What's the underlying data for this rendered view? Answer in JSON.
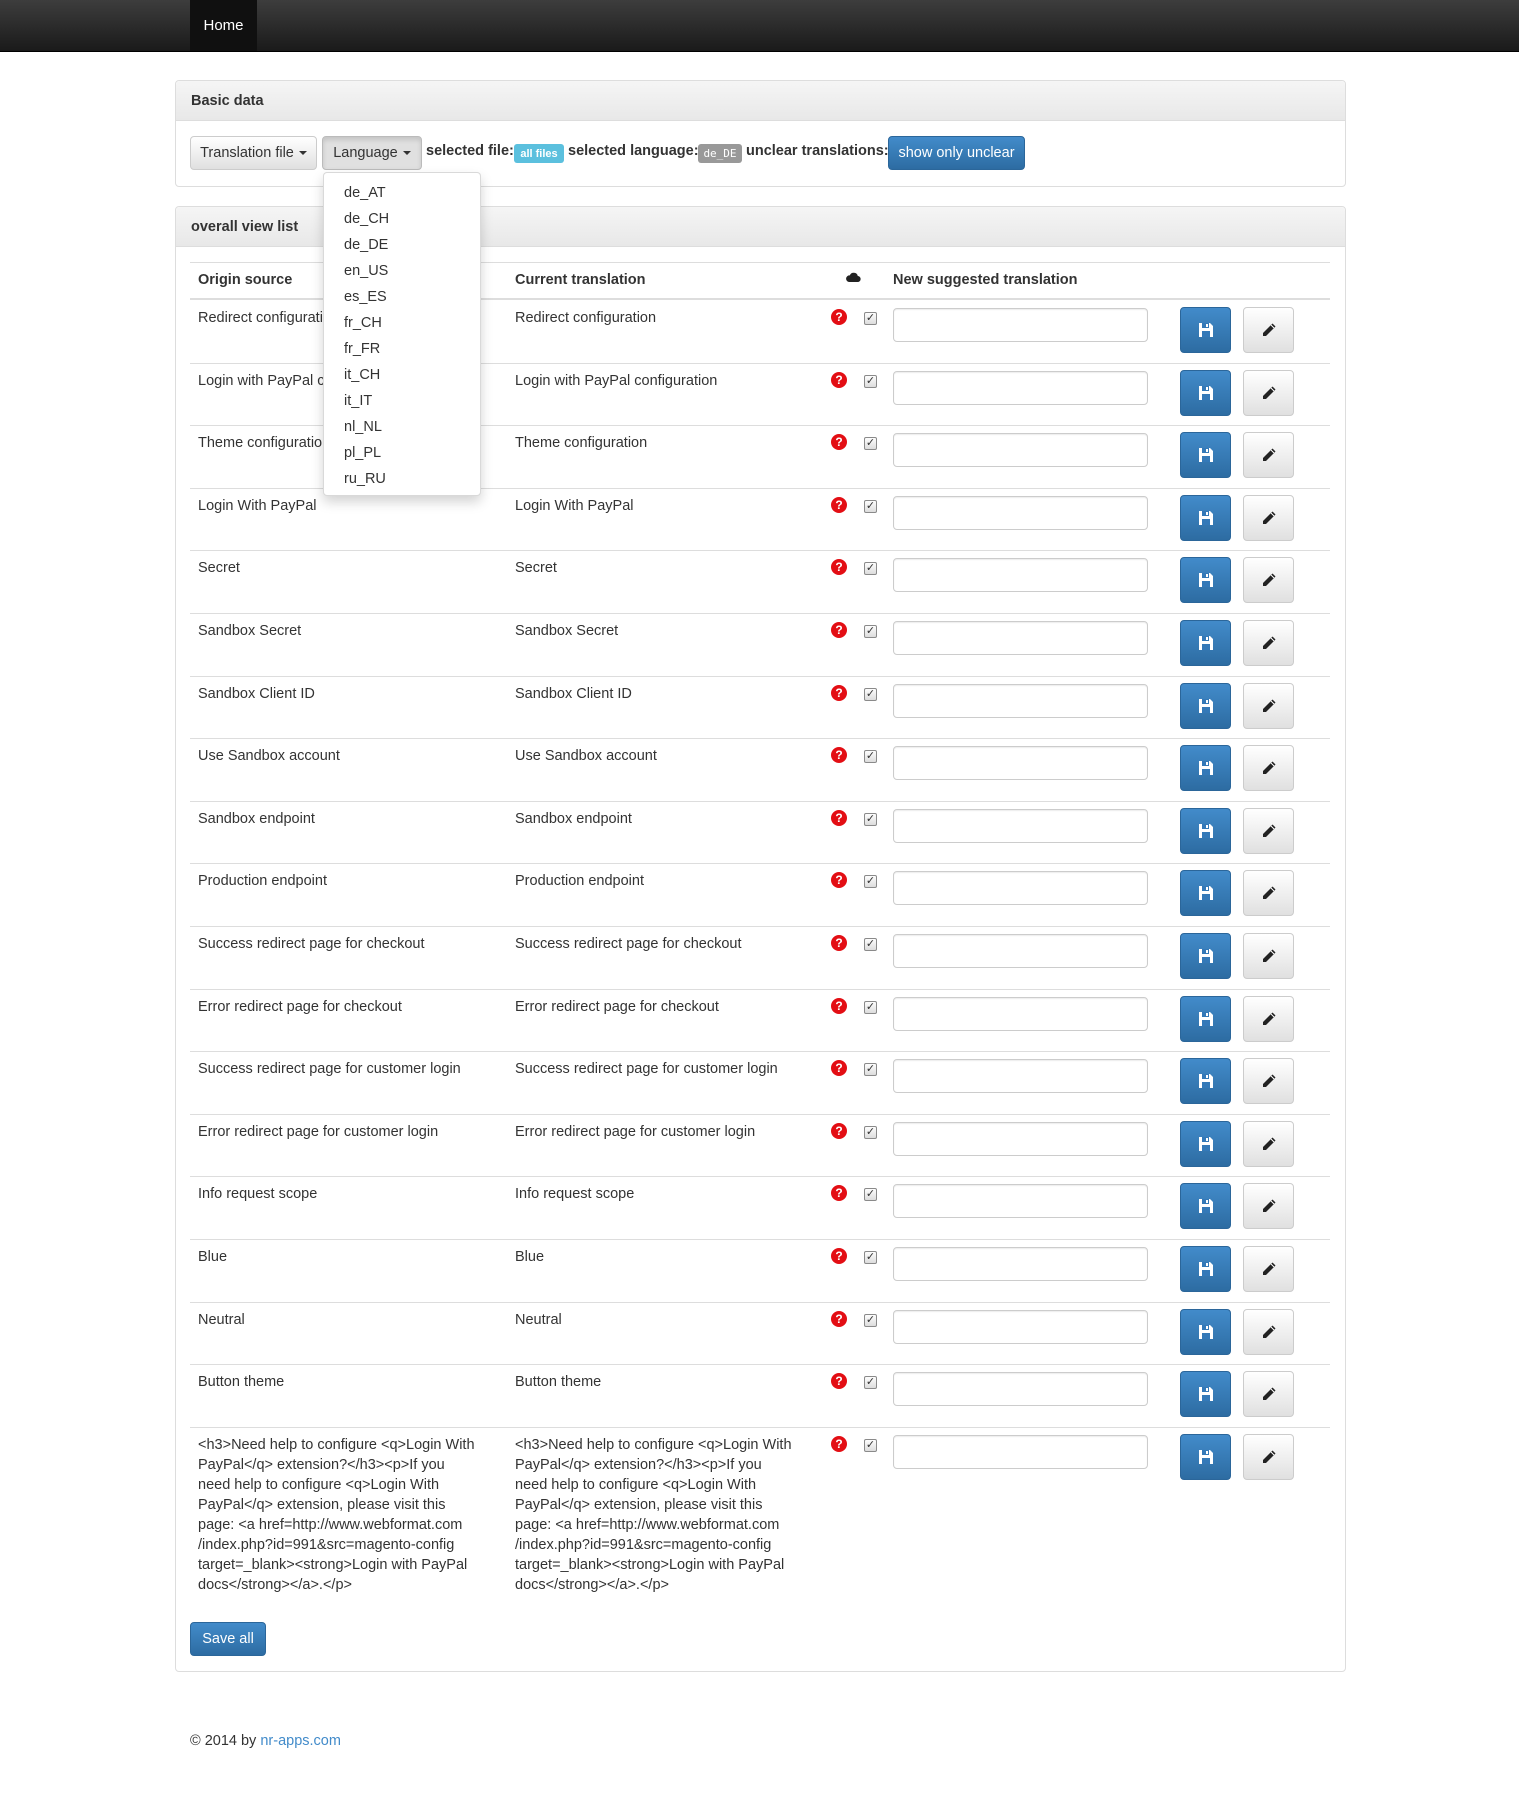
{
  "nav": {
    "home": "Home"
  },
  "basic_panel": {
    "title": "Basic data",
    "translation_file_button": "Translation file",
    "language_button": "Language",
    "selected_file_label": "selected file:",
    "selected_file_value": "all files",
    "selected_language_label": "selected language:",
    "selected_language_value": "de_DE",
    "unclear_label": "unclear translations:",
    "show_unclear_button": "show only unclear"
  },
  "language_menu": [
    "de_AT",
    "de_CH",
    "de_DE",
    "en_US",
    "es_ES",
    "fr_CH",
    "fr_FR",
    "it_CH",
    "it_IT",
    "nl_NL",
    "pl_PL",
    "ru_RU"
  ],
  "list_panel": {
    "title": "overall view list",
    "headers": {
      "origin": "Origin source",
      "current": "Current translation",
      "suggested": "New suggested translation"
    },
    "rows": [
      {
        "origin": "Redirect configuration",
        "current": "Redirect configuration"
      },
      {
        "origin": "Login with PayPal configuration",
        "current": "Login with PayPal configuration"
      },
      {
        "origin": "Theme configuration",
        "current": "Theme configuration"
      },
      {
        "origin": "Login With PayPal",
        "current": "Login With PayPal"
      },
      {
        "origin": "Secret",
        "current": "Secret"
      },
      {
        "origin": "Sandbox Secret",
        "current": "Sandbox Secret"
      },
      {
        "origin": "Sandbox Client ID",
        "current": "Sandbox Client ID"
      },
      {
        "origin": "Use Sandbox account",
        "current": "Use Sandbox account"
      },
      {
        "origin": "Sandbox endpoint",
        "current": "Sandbox endpoint"
      },
      {
        "origin": "Production endpoint",
        "current": "Production endpoint"
      },
      {
        "origin": "Success redirect page for checkout",
        "current": "Success redirect page for checkout"
      },
      {
        "origin": "Error redirect page for checkout",
        "current": "Error redirect page for checkout"
      },
      {
        "origin": "Success redirect page for customer login",
        "current": "Success redirect page for customer login"
      },
      {
        "origin": "Error redirect page for customer login",
        "current": "Error redirect page for customer login"
      },
      {
        "origin": "Info request scope",
        "current": "Info request scope"
      },
      {
        "origin": "Blue",
        "current": "Blue"
      },
      {
        "origin": "Neutral",
        "current": "Neutral"
      },
      {
        "origin": "Button theme",
        "current": "Button theme"
      },
      {
        "origin": "<h3>Need help to configure <q>Login With PayPal</q> extension?</h3><p>If you need help to configure <q>Login With PayPal</q> extension, please visit this page: <a href=http://www.webformat.com /index.php?id=991&src=magento-config target=_blank><strong>Login with PayPal docs</strong></a>.</p>",
        "current": "<h3>Need help to configure <q>Login With PayPal</q> extension?</h3><p>If you need help to configure <q>Login With PayPal</q> extension, please visit this page: <a href=http://www.webformat.com /index.php?id=991&src=magento-config target=_blank><strong>Login with PayPal docs</strong></a>.</p>"
      }
    ],
    "save_all_button": "Save all"
  },
  "footer": {
    "text": "© 2014 by ",
    "link": "nr-apps.com"
  },
  "colors": {
    "primary": "#428bca",
    "info": "#5bc0de",
    "grey_label": "#999999",
    "danger": "#e30e14"
  }
}
